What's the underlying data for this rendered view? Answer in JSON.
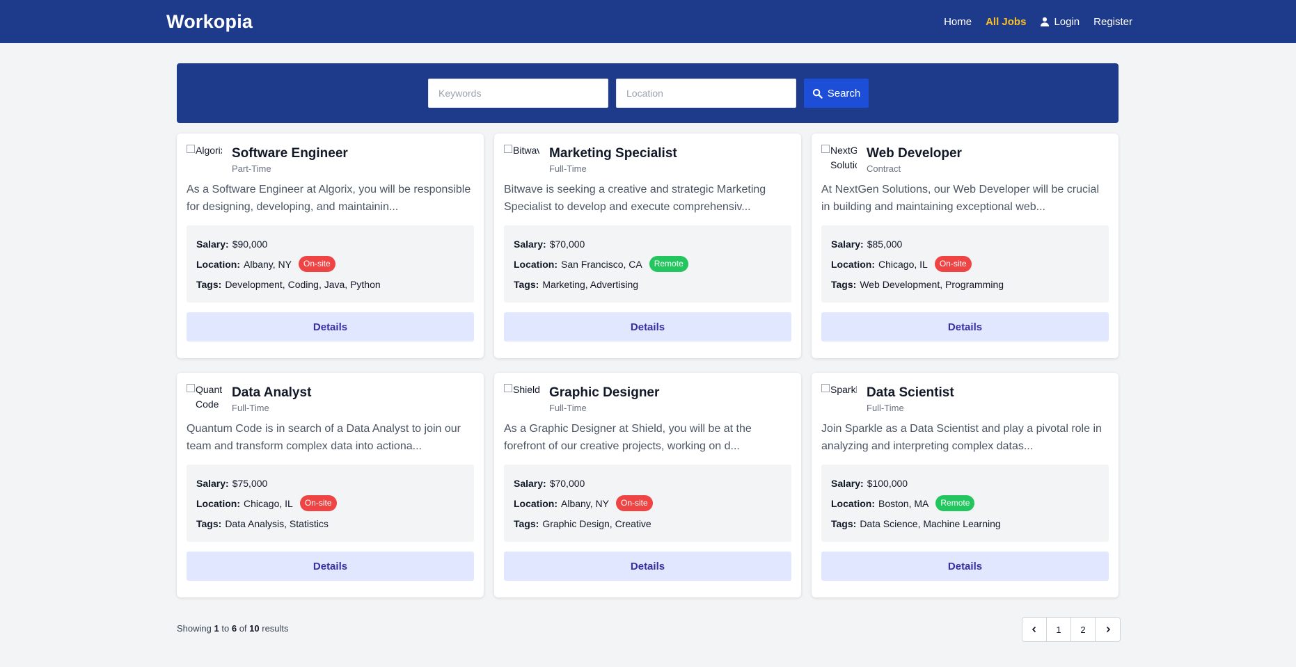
{
  "header": {
    "brand": "Workopia",
    "nav": [
      {
        "label": "Home"
      },
      {
        "label": "All Jobs",
        "active": true
      },
      {
        "label": "Login",
        "icon": "user-icon"
      },
      {
        "label": "Register"
      }
    ]
  },
  "search": {
    "keywords_placeholder": "Keywords",
    "location_placeholder": "Location",
    "button_label": "Search"
  },
  "labels": {
    "salary": "Salary:",
    "location": "Location:",
    "tags": "Tags:",
    "details": "Details"
  },
  "jobs": [
    {
      "logo_alt": "Algorix",
      "title": "Software Engineer",
      "type": "Part-Time",
      "description": "As a Software Engineer at Algorix, you will be responsible for designing, developing, and maintainin...",
      "salary": "$90,000",
      "location": "Albany, NY",
      "badge": "On-site",
      "tags": "Development, Coding, Java, Python"
    },
    {
      "logo_alt": "Bitwave",
      "title": "Marketing Specialist",
      "type": "Full-Time",
      "description": "Bitwave is seeking a creative and strategic Marketing Specialist to develop and execute comprehensiv...",
      "salary": "$70,000",
      "location": "San Francisco, CA",
      "badge": "Remote",
      "tags": "Marketing, Advertising"
    },
    {
      "logo_alt": "NextGen Solutions",
      "title": "Web Developer",
      "type": "Contract",
      "description": "At NextGen Solutions, our Web Developer will be crucial in building and maintaining exceptional web...",
      "salary": "$85,000",
      "location": "Chicago, IL",
      "badge": "On-site",
      "tags": "Web Development, Programming"
    },
    {
      "logo_alt": "Quantum Code",
      "title": "Data Analyst",
      "type": "Full-Time",
      "description": "Quantum Code is in search of a Data Analyst to join our team and transform complex data into actiona...",
      "salary": "$75,000",
      "location": "Chicago, IL",
      "badge": "On-site",
      "tags": "Data Analysis, Statistics"
    },
    {
      "logo_alt": "Shield",
      "title": "Graphic Designer",
      "type": "Full-Time",
      "description": "As a Graphic Designer at Shield, you will be at the forefront of our creative projects, working on d...",
      "salary": "$70,000",
      "location": "Albany, NY",
      "badge": "On-site",
      "tags": "Graphic Design, Creative"
    },
    {
      "logo_alt": "Sparkle",
      "title": "Data Scientist",
      "type": "Full-Time",
      "description": "Join Sparkle as a Data Scientist and play a pivotal role in analyzing and interpreting complex datas...",
      "salary": "$100,000",
      "location": "Boston, MA",
      "badge": "Remote",
      "tags": "Data Science, Machine Learning"
    }
  ],
  "pagination": {
    "showing_prefix": "Showing",
    "from": "1",
    "to_word": "to",
    "to": "6",
    "of_word": "of",
    "total": "10",
    "results_word": "results",
    "pages": [
      "1",
      "2"
    ]
  },
  "colors": {
    "header_bg": "#1e3a8a",
    "active_nav": "#fbbf24",
    "onsite_badge": "#ef4444",
    "remote_badge": "#22c55e",
    "details_bg": "#e0e7ff"
  }
}
